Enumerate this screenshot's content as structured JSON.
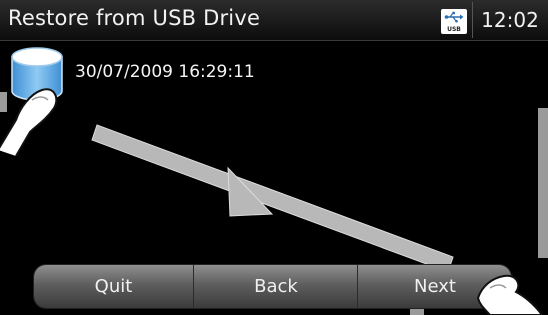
{
  "header": {
    "title": "Restore from USB Drive",
    "usb_badge": {
      "icon": "usb-icon",
      "label": "USB"
    },
    "clock": "12:02"
  },
  "backups": [
    {
      "icon": "drive-icon",
      "label": "30/07/2009 16:29:11"
    }
  ],
  "navbar": {
    "quit_label": "Quit",
    "back_label": "Back",
    "next_label": "Next"
  },
  "colors": {
    "background": "#000000",
    "title_bar": "#1a1a1a",
    "drive_icon": "#6fb6ea",
    "gesture_arrow": "#b8b8b8"
  }
}
